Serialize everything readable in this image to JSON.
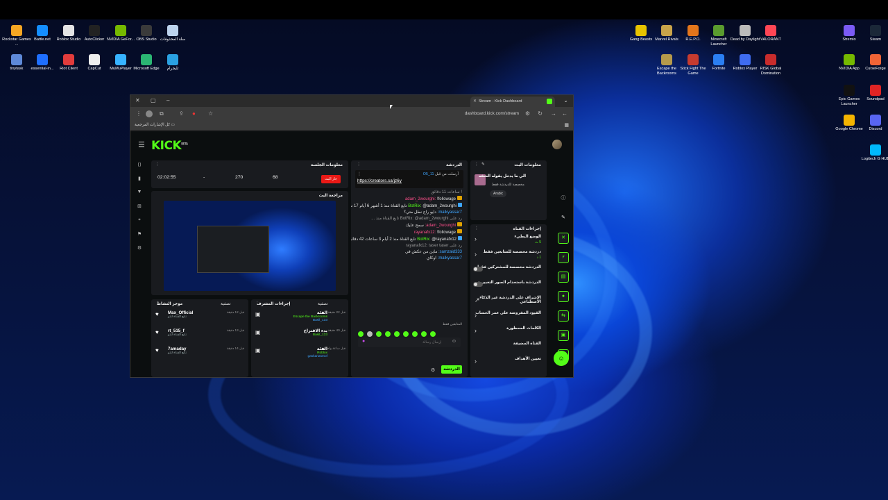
{
  "desktop": {
    "left_icons": [
      {
        "label": "Rockstar Games ...",
        "color": "#f5a623"
      },
      {
        "label": "Battle.net",
        "color": "#148eff"
      },
      {
        "label": "Roblox Studio",
        "color": "#e4e4e4"
      },
      {
        "label": "AutoClicker",
        "color": "#222222"
      },
      {
        "label": "NVIDIA GeFor...",
        "color": "#76b900"
      },
      {
        "label": "OBS Studio",
        "color": "#3a3a3a"
      },
      {
        "label": "سلة المحذوفات",
        "color": "#bcd3ee"
      },
      {
        "label": "tinytask",
        "color": "#5e89d8"
      },
      {
        "label": "essential-in...",
        "color": "#1f6fff"
      },
      {
        "label": "Riot Client",
        "color": "#e23c3c"
      },
      {
        "label": "CapCut",
        "color": "#eeeeee"
      },
      {
        "label": "MuMuPlayer",
        "color": "#37b3ff"
      },
      {
        "label": "Microsoft Edge",
        "color": "#2bb673"
      },
      {
        "label": "تليجرام",
        "color": "#2aa1e2"
      }
    ],
    "mid_icons": [
      {
        "label": "Gang Beasts",
        "color": "#e8c400"
      },
      {
        "label": "Marvel Rivals",
        "color": "#c9a44a"
      },
      {
        "label": "R.E.P.O.",
        "color": "#e4761b"
      },
      {
        "label": "Minecraft Launcher",
        "color": "#5a9b2e"
      },
      {
        "label": "Dead by Daylight",
        "color": "#bbbbbb"
      },
      {
        "label": "VALORANT",
        "color": "#ff4655"
      },
      {
        "label": "Escape the Backrooms",
        "color": "#b59a4b"
      },
      {
        "label": "Stick Fight The Game",
        "color": "#c63b2f"
      },
      {
        "label": "Fortnite",
        "color": "#2b7ff2"
      },
      {
        "label": "Roblox Player",
        "color": "#3f6cf0"
      },
      {
        "label": "RISK Global Domination",
        "color": "#c82c2c"
      }
    ],
    "right_icons": [
      {
        "label": "Stremio",
        "color": "#7b5bf5"
      },
      {
        "label": "Steam",
        "color": "#1b2838"
      },
      {
        "label": "NVIDIA App",
        "color": "#76b900"
      },
      {
        "label": "CurseForge",
        "color": "#f16436"
      },
      {
        "label": "Epic Games Launcher",
        "color": "#111111"
      },
      {
        "label": "Soundpad",
        "color": "#e02424"
      },
      {
        "label": "Google Chrome",
        "color": "#f4b400"
      },
      {
        "label": "Discord",
        "color": "#5865f2"
      },
      {
        "label": "Logitech G HUB",
        "color": "#00b8fc"
      }
    ]
  },
  "browser": {
    "tab_title": "Stream - Kick Dashboard",
    "url": "dashboard.kick.com/stream",
    "bookmarks_label": "كل الإشارات المرجعية"
  },
  "kick": {
    "logo": "KICK",
    "logo_sup": "BETA",
    "session": {
      "title": "معلومات الجلسة",
      "live_label": "جار البث",
      "viewers": "68",
      "followers": "270",
      "subs": "-",
      "duration": "02:02:55"
    },
    "preview_title": "مراجعة البث",
    "activity": {
      "title": "موجز النشاط",
      "filter": "تصفية",
      "items": [
        {
          "name": "Max_Official",
          "sub": "تابع القناة للتو",
          "time": "قبل 12 دقيقة"
        },
        {
          "name": "rt_515_f",
          "sub": "تابع القناة للتو",
          "time": "قبل 13 دقيقة"
        },
        {
          "name": "7amaday",
          "sub": "تابع القناة للتو",
          "time": "قبل 14 دقيقة"
        }
      ]
    },
    "moderation": {
      "title": "إجراءات المشرف",
      "filter": "تصفية",
      "items": [
        {
          "title": "الفئة",
          "sub": "Escape the Backrooms",
          "user": "Basil_133",
          "time": "قبل 22 دقيقة"
        },
        {
          "title": "بدء الاقتراع",
          "sub": "Basil_133",
          "user": "",
          "time": "قبل 40 دقيقة"
        },
        {
          "title": "الفئة",
          "sub": "Roblox",
          "user": "gaskanasmof",
          "time": "قبل ساعة واحدة"
        }
      ]
    },
    "chat": {
      "title": "الدردشة",
      "pinned_user": "O5_11",
      "pinned_text": "أرسلت من قبل",
      "pinned_link": "https://creators.sa/jz6y",
      "lines": [
        {
          "user": "",
          "text": "! ساعات 11 دقائق",
          "cls": ""
        },
        {
          "user": "adam_2wourghi",
          "text": "!followage",
          "cls": "u-pink",
          "crown": true
        },
        {
          "user": "BotRix",
          "text": "@adam_2wourghi تابع القناة منذ 1 أشهر 6 أيام 17 ساعات 15 دقائق !",
          "cls": "u-green",
          "bot": true
        },
        {
          "user": "malkyassar7",
          "text": "دايو راح نطل متي؟",
          "cls": "u-blue"
        },
        {
          "user": "",
          "text": "رد على BotRix: @adam_2wourghi تابع القناة منذ ...",
          "cls": ""
        },
        {
          "user": "adam_2wourghi",
          "text": "سمح عليك",
          "cls": "u-pink",
          "crown": true
        },
        {
          "user": "rayanafx12",
          "text": "!followage",
          "cls": "u-pink",
          "crown": true
        },
        {
          "user": "BotRix",
          "text": "@rayanafx12 تابع القناة منذ 2 أيام 3 ساعات 42 دقائق !",
          "cls": "u-green",
          "bot": true
        },
        {
          "user": "",
          "text": "رد على rayanafx12: taser taser",
          "cls": ""
        },
        {
          "user": "samzaid333",
          "text": "ماين من عكش في",
          "cls": "u-blue"
        },
        {
          "user": "malkyassar7",
          "text": "اوكاي",
          "cls": "u-blue"
        }
      ],
      "placeholder": "إرسال رسالة",
      "send_label": "الدردشة",
      "emotes_label": "المتابعين فقط"
    },
    "stream_info": {
      "title": "معلومات البث",
      "stream_title": "الي ما يدخل يقوله الشفه",
      "stream_sub": "مخصصة للدردشة فقط",
      "language": "Arabic"
    },
    "quick_actions": {
      "title": "إجراءات القناة",
      "rows": [
        {
          "label": "الوضع البطيء",
          "sub": "5 ث",
          "kind": "arrow"
        },
        {
          "label": "دردشة مخصصة للمتابعين فقط",
          "sub": "1 د",
          "kind": "arrow"
        },
        {
          "label": "الدردشة مخصصة للمشتركين فقط",
          "sub": "",
          "kind": "toggle"
        },
        {
          "label": "الدردشة باستخدام الصور التعبيرية",
          "sub": "",
          "kind": "toggle"
        },
        {
          "label": "الإشراف على الدردشة عبر الذكاء الاصطناعي",
          "sub": "",
          "kind": "ext"
        },
        {
          "label": "القيود المفروضة على عمر الحساب",
          "sub": "",
          "kind": "arrow"
        },
        {
          "label": "الكلمات المحظورة",
          "sub": "",
          "kind": "arrow"
        },
        {
          "label": "القناة المضيفة",
          "sub": "",
          "kind": "none"
        },
        {
          "label": "تعيين الأهداف",
          "sub": "",
          "kind": "arrow"
        }
      ]
    }
  }
}
